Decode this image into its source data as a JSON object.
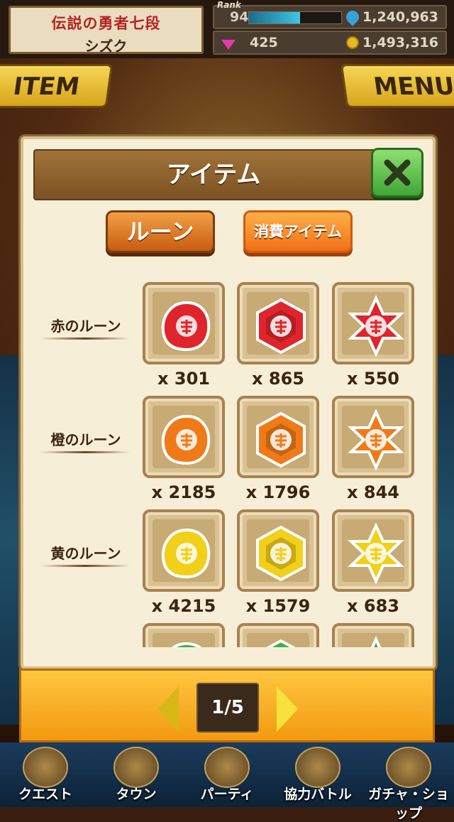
{
  "topbar": {
    "player_title": "伝説の勇者七段",
    "player_name": "シズク",
    "rank_label": "Rank",
    "rank": "94",
    "rank_progress_percent": 55,
    "stamina": "1,240,963",
    "gems": "425",
    "coins": "1,493,316"
  },
  "side_buttons": {
    "item": "ITEM",
    "menu": "MENU"
  },
  "dialog": {
    "title": "アイテム",
    "tabs": [
      {
        "label": "ルーン",
        "active": true
      },
      {
        "label": "消費アイテム",
        "active": false
      }
    ],
    "rows": [
      {
        "label": "赤のルーン",
        "color": "#e0242c",
        "items": [
          {
            "shape": "round",
            "count": "x 301"
          },
          {
            "shape": "hexagon",
            "count": "x 865"
          },
          {
            "shape": "star",
            "count": "x 550"
          }
        ]
      },
      {
        "label": "橙のルーン",
        "color": "#f07a18",
        "items": [
          {
            "shape": "round",
            "count": "x 2185"
          },
          {
            "shape": "hexagon",
            "count": "x 1796"
          },
          {
            "shape": "star",
            "count": "x 844"
          }
        ]
      },
      {
        "label": "黄のルーン",
        "color": "#f2cf18",
        "items": [
          {
            "shape": "round",
            "count": "x 4215"
          },
          {
            "shape": "hexagon",
            "count": "x 1579"
          },
          {
            "shape": "star",
            "count": "x 683"
          }
        ]
      },
      {
        "label": "",
        "color": "#3fae4a",
        "items": [
          {
            "shape": "round",
            "count": ""
          },
          {
            "shape": "hexagon",
            "count": ""
          },
          {
            "shape": "star",
            "count": ""
          }
        ]
      }
    ]
  },
  "pager": {
    "page": "1/5"
  },
  "bottom_nav": [
    {
      "label": "クエスト",
      "icon": "quest-icon"
    },
    {
      "label": "タウン",
      "icon": "town-icon"
    },
    {
      "label": "パーティ",
      "icon": "party-icon"
    },
    {
      "label": "協力バトル",
      "icon": "coop-battle-icon"
    },
    {
      "label": "ガチャ・ショップ",
      "icon": "gacha-shop-icon"
    }
  ]
}
